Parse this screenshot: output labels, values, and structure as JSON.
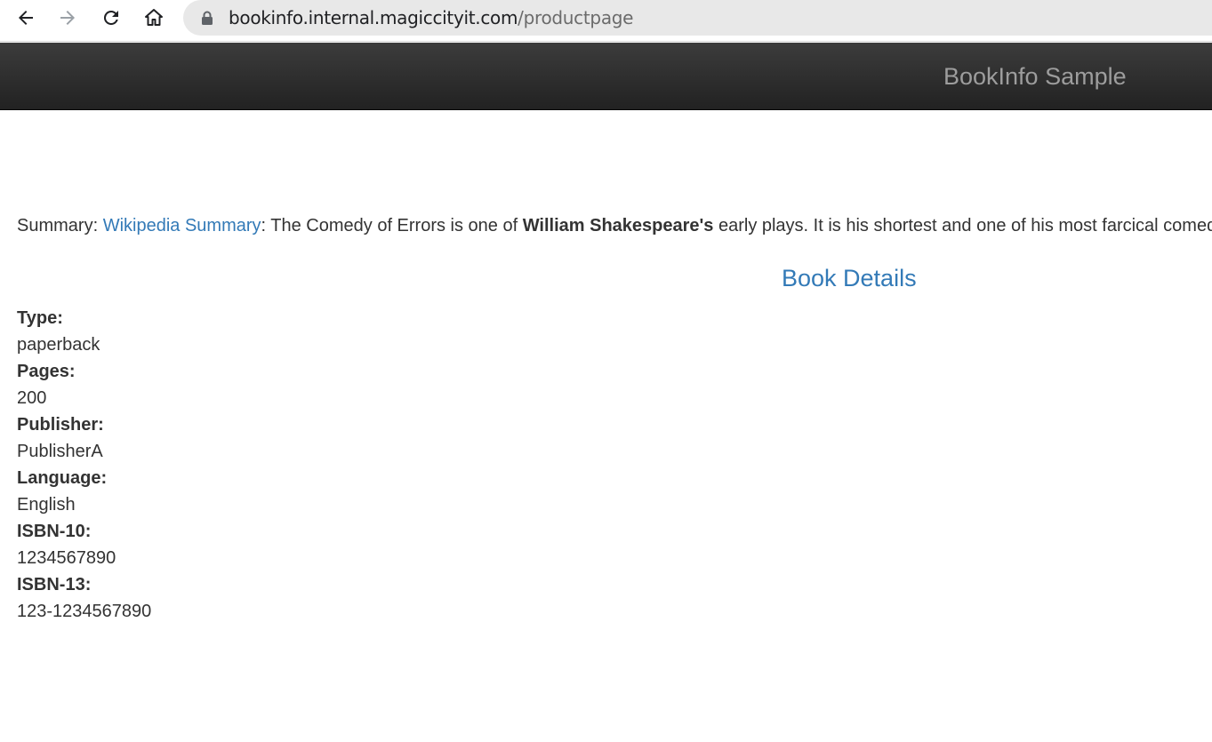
{
  "browser": {
    "url_host": "bookinfo.internal.magiccityit.com",
    "url_path": "/productpage",
    "icons": [
      "back-arrow-icon",
      "forward-arrow-icon",
      "reload-icon",
      "home-icon",
      "lock-icon"
    ]
  },
  "header": {
    "brand": "BookInfo Sample"
  },
  "summary": {
    "label": "Summary: ",
    "link_text": "Wikipedia Summary",
    "after_link": ": The Comedy of Errors is one of ",
    "bold": "William Shakespeare's",
    "rest": " early plays. It is his shortest and one of his most farcical comedies, with a major part of the humour coming from slapstick and mistaken identity"
  },
  "details": {
    "title": "Book Details",
    "fields": [
      {
        "label": "Type:",
        "value": "paperback"
      },
      {
        "label": "Pages:",
        "value": "200"
      },
      {
        "label": "Publisher:",
        "value": "PublisherA"
      },
      {
        "label": "Language:",
        "value": "English"
      },
      {
        "label": "ISBN-10:",
        "value": "1234567890"
      },
      {
        "label": "ISBN-13:",
        "value": "123-1234567890"
      }
    ]
  },
  "colors": {
    "link": "#337ab7",
    "navbar": "#222222",
    "brand_text": "#9d9d9d",
    "text": "#333333"
  }
}
